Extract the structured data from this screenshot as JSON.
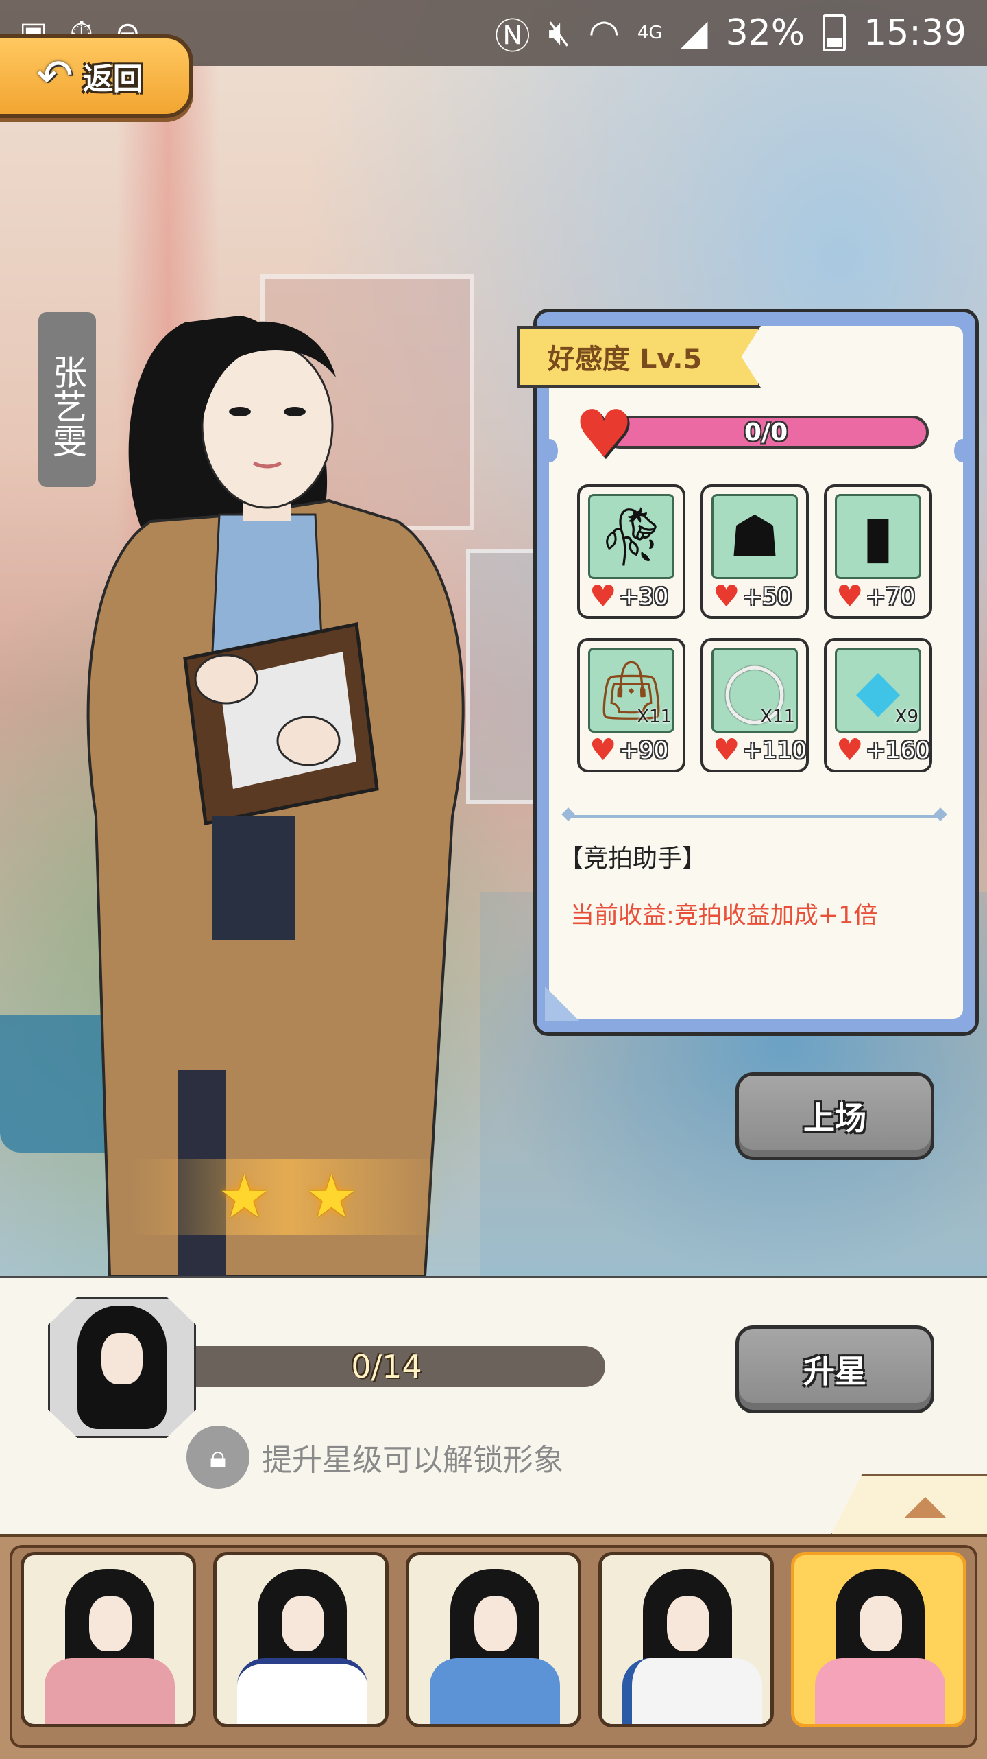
{
  "status_bar": {
    "left_icons": [
      "image-icon",
      "timer-icon",
      "do-not-disturb-icon"
    ],
    "right_icons": [
      "nfc-icon",
      "mute-icon",
      "wifi-icon",
      "signal-icon",
      "battery-icon"
    ],
    "network": "4G",
    "battery": "32%",
    "time": "15:39"
  },
  "back_button": {
    "label": "返回"
  },
  "character": {
    "name": "张艺雯",
    "stars": 2
  },
  "affection_panel": {
    "level_label": "好感度 Lv.5",
    "progress_text": "0/0",
    "progress_fraction": 0,
    "gifts": [
      {
        "icon": "rose-icon",
        "count": "",
        "reward": "+30"
      },
      {
        "icon": "cake-icon",
        "count": "",
        "reward": "+50"
      },
      {
        "icon": "lipstick-icon",
        "count": "",
        "reward": "+70"
      },
      {
        "icon": "handbag-icon",
        "count": "X11",
        "reward": "+90"
      },
      {
        "icon": "necklace-icon",
        "count": "X11",
        "reward": "+110"
      },
      {
        "icon": "diamond-icon",
        "count": "X9",
        "reward": "+160"
      }
    ],
    "skill_title": "【竞拍助手】",
    "skill_desc": "当前收益:竞拍收益加成+1倍"
  },
  "buttons": {
    "deploy": "上场",
    "star_up": "升星"
  },
  "shards": {
    "progress_text": "0/14",
    "progress_fraction": 0
  },
  "unlock_hint": "提升星级可以解锁形象",
  "roster": {
    "count": 5,
    "selected_index": 4
  },
  "colors": {
    "accent_orange": "#f2a531",
    "affection_pink": "#ec6aa3",
    "panel_blue": "#8aa9e0",
    "skill_red": "#e8503a",
    "selected_card": "#ffd25a"
  }
}
